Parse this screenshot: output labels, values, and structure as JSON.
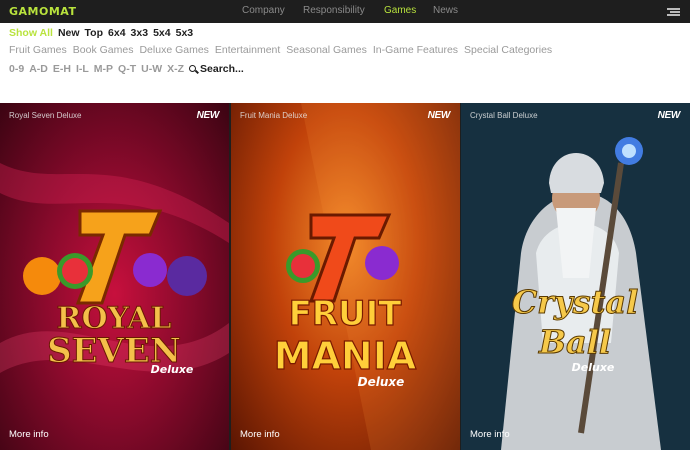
{
  "brand": {
    "logo": "GAMOMAT",
    "accent": "#b9e33d"
  },
  "nav": {
    "items": [
      {
        "label": "Company",
        "active": false
      },
      {
        "label": "Responsibility",
        "active": false
      },
      {
        "label": "Games",
        "active": true
      },
      {
        "label": "News",
        "active": false
      }
    ]
  },
  "filters": {
    "row1": [
      "Show All",
      "New",
      "Top",
      "6x4",
      "3x3",
      "5x4",
      "5x3"
    ],
    "row2": [
      "Fruit Games",
      "Book Games",
      "Deluxe Games",
      "Entertainment",
      "Seasonal Games",
      "In-Game Features",
      "Special Categories"
    ],
    "row3": [
      "0-9",
      "A-D",
      "E-H",
      "I-L",
      "M-P",
      "Q-T",
      "U-W",
      "X-Z"
    ],
    "search_label": "Search..."
  },
  "games": [
    {
      "title": "Royal Seven Deluxe",
      "badge": "NEW",
      "more": "More info",
      "logo_lines": [
        "ROYAL",
        "SEVEN",
        "Deluxe"
      ]
    },
    {
      "title": "Fruit Mania Deluxe",
      "badge": "NEW",
      "more": "More info",
      "logo_lines": [
        "FRUIT",
        "MANIA",
        "Deluxe"
      ]
    },
    {
      "title": "Crystal Ball Deluxe",
      "badge": "NEW",
      "more": "More info",
      "logo_lines": [
        "Crystal",
        "Ball",
        "Deluxe"
      ]
    }
  ]
}
